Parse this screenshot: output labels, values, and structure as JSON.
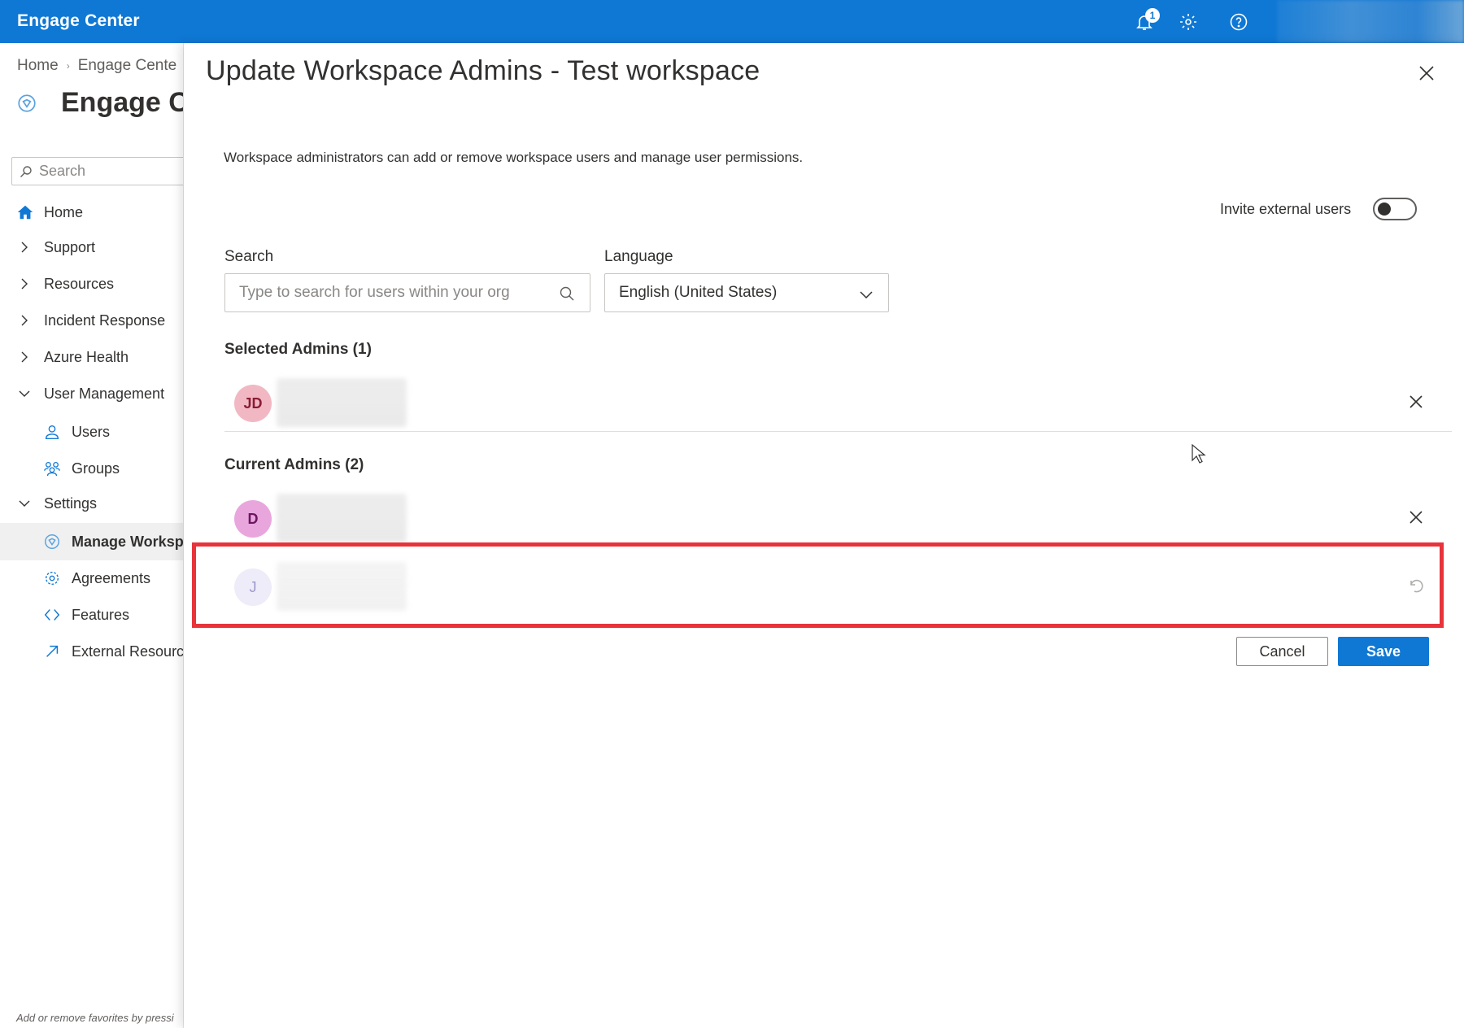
{
  "topbar": {
    "app_title": "Engage Center",
    "notification_count": "1",
    "icons": [
      "bell-icon",
      "gear-icon",
      "help-icon"
    ]
  },
  "leftpane": {
    "breadcrumb": [
      "Home",
      "Engage Cente"
    ],
    "page_title": "Engage Ce",
    "search_placeholder": "Search",
    "nav": [
      {
        "label": "Home",
        "icon": "home-icon"
      },
      {
        "label": "Support",
        "icon": "chevron-right-icon"
      },
      {
        "label": "Resources",
        "icon": "chevron-right-icon"
      },
      {
        "label": "Incident Response",
        "icon": "chevron-right-icon"
      },
      {
        "label": "Azure Health",
        "icon": "chevron-right-icon"
      },
      {
        "label": "User Management",
        "icon": "chevron-down-icon"
      },
      {
        "label": "Users",
        "icon": "person-icon"
      },
      {
        "label": "Groups",
        "icon": "group-icon"
      },
      {
        "label": "Settings",
        "icon": "chevron-down-icon"
      },
      {
        "label": "Manage Worksp",
        "icon": "workspace-icon",
        "active": true
      },
      {
        "label": "Agreements",
        "icon": "gear-icon"
      },
      {
        "label": "Features",
        "icon": "features-icon"
      },
      {
        "label": "External Resource",
        "icon": "external-link-icon"
      }
    ],
    "footer_hint": "Add or remove favorites by pressi"
  },
  "panel": {
    "title": "Update Workspace Admins - Test workspace",
    "description": "Workspace administrators can add or remove workspace users and manage user permissions.",
    "invite_external_label": "Invite external users",
    "invite_external_on": false,
    "search_label": "Search",
    "search_placeholder": "Type to search for users within your org",
    "language_label": "Language",
    "language_value": "English (United States)",
    "selected_admins_title": "Selected Admins (1)",
    "selected_admins": [
      {
        "initials": "JD",
        "avatar_bg": "#f1b8c4",
        "avatar_fg": "#8a1c34"
      }
    ],
    "current_admins_title": "Current Admins (2)",
    "current_admins": [
      {
        "initials": "D",
        "avatar_bg": "#e9a6dd",
        "avatar_fg": "#6b1660",
        "action": "remove"
      },
      {
        "initials": "J",
        "avatar_bg": "#ebe9f7",
        "avatar_fg": "#8c86c4",
        "action": "undo"
      }
    ],
    "cancel_label": "Cancel",
    "save_label": "Save"
  },
  "colors": {
    "brand": "#0f78d4",
    "highlight": "#e8333b"
  }
}
